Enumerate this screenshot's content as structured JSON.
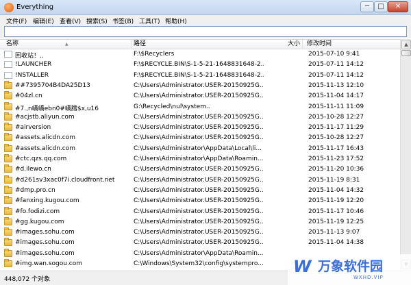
{
  "window": {
    "title": "Everything",
    "min": "─",
    "max": "□",
    "close": "✕"
  },
  "menu": [
    "文件(F)",
    "编辑(E)",
    "查看(V)",
    "搜索(S)",
    "书签(B)",
    "工具(T)",
    "帮助(H)"
  ],
  "search": {
    "value": "",
    "placeholder": ""
  },
  "columns": {
    "name": "名称",
    "path": "路径",
    "size": "大小",
    "date": "修改时间"
  },
  "rows": [
    {
      "icon": "recycle-bin-icon",
      "name": "回收站！..",
      "path": "F:\\$Recyclers",
      "date": "2015-07-10 9:41"
    },
    {
      "icon": "file-icon",
      "name": "!LAUNCHER",
      "path": "F:\\$RECYCLE.BIN\\S-1-5-21-1648831648-2...",
      "date": "2015-07-11 14:12"
    },
    {
      "icon": "file-icon",
      "name": "!NSTALLER",
      "path": "F:\\$RECYCLE.BIN\\S-1-5-21-1648831648-2...",
      "date": "2015-07-11 14:12"
    },
    {
      "icon": "folder-icon",
      "name": "##7395704B4DA25D13",
      "path": "C:\\Users\\Administrator.USER-20150925G...",
      "date": "2015-11-13 12:10"
    },
    {
      "icon": "folder-icon",
      "name": "#04zl.cn",
      "path": "C:\\Users\\Administrator.USER-20150925G...",
      "date": "2015-11-04 14:17"
    },
    {
      "icon": "folder-icon",
      "name": "#7.,n嶠嶠ebn0#嶠膤$x,u16",
      "path": "G:\\Recycled\\nul\\system..",
      "date": "2015-11-11 11:09"
    },
    {
      "icon": "folder-icon",
      "name": "#acjstb.aliyun.com",
      "path": "C:\\Users\\Administrator.USER-20150925G...",
      "date": "2015-10-28 12:27"
    },
    {
      "icon": "folder-icon",
      "name": "#airversion",
      "path": "C:\\Users\\Administrator.USER-20150925G...",
      "date": "2015-11-17 11:29"
    },
    {
      "icon": "folder-icon",
      "name": "#assets.alicdn.com",
      "path": "C:\\Users\\Administrator.USER-20150925G...",
      "date": "2015-10-28 12:27"
    },
    {
      "icon": "folder-icon",
      "name": "#assets.alicdn.com",
      "path": "C:\\Users\\Administrator\\AppData\\Local\\li...",
      "date": "2015-11-17 16:43"
    },
    {
      "icon": "folder-icon",
      "name": "#ctc.qzs.qq.com",
      "path": "C:\\Users\\Administrator\\AppData\\Roamin...",
      "date": "2015-11-23 17:52"
    },
    {
      "icon": "folder-icon",
      "name": "#d.ilewo.cn",
      "path": "C:\\Users\\Administrator.USER-20150925G...",
      "date": "2015-11-20 10:36"
    },
    {
      "icon": "folder-icon",
      "name": "#d261sv3xac0f7i.cloudfront.net",
      "path": "C:\\Users\\Administrator.USER-20150925G...",
      "date": "2015-11-19 8:31"
    },
    {
      "icon": "folder-icon",
      "name": "#dmp.pro.cn",
      "path": "C:\\Users\\Administrator.USER-20150925G...",
      "date": "2015-11-04 14:32"
    },
    {
      "icon": "folder-icon",
      "name": "#fanxing.kugou.com",
      "path": "C:\\Users\\Administrator.USER-20150925G...",
      "date": "2015-11-19 12:20"
    },
    {
      "icon": "folder-icon",
      "name": "#fo.fodizi.com",
      "path": "C:\\Users\\Administrator.USER-20150925G...",
      "date": "2015-11-17 10:46"
    },
    {
      "icon": "folder-icon",
      "name": "#gg.kugou.com",
      "path": "C:\\Users\\Administrator.USER-20150925G...",
      "date": "2015-11-19 12:25"
    },
    {
      "icon": "folder-icon",
      "name": "#images.sohu.com",
      "path": "C:\\Users\\Administrator.USER-20150925G...",
      "date": "2015-11-13 9:07"
    },
    {
      "icon": "folder-icon",
      "name": "#images.sohu.com",
      "path": "C:\\Users\\Administrator.USER-20150925G...",
      "date": "2015-11-04 14:38"
    },
    {
      "icon": "folder-icon",
      "name": "#images.sohu.com",
      "path": "C:\\Users\\Administrator\\AppData\\Roamin...",
      "date": ""
    },
    {
      "icon": "folder-icon",
      "name": "#img.wan.sogou.com",
      "path": "C:\\Windows\\System32\\config\\systempro...",
      "date": ""
    }
  ],
  "status": "448,072 个对象",
  "watermark": {
    "logo": "W",
    "text": "万象软件园",
    "sub": "WXHD.VIP"
  }
}
